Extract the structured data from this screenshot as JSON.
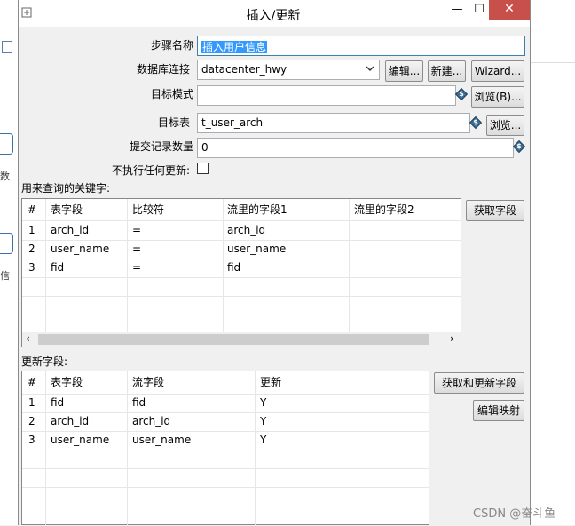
{
  "window": {
    "title": "插入/更新",
    "minimize_glyph": "—",
    "maximize_glyph": "☐",
    "close_glyph": "✕"
  },
  "background": {
    "left_fragment_1": "数",
    "left_fragment_2": "信",
    "right_fragment": "ad"
  },
  "form": {
    "step_name_label": "步骤名称",
    "step_name_value": "插入用户信息",
    "db_connection_label": "数据库连接",
    "db_connection_value": "datacenter_hwy",
    "edit_button": "编辑...",
    "new_button": "新建...",
    "wizard_button": "Wizard...",
    "target_schema_label": "目标模式",
    "target_schema_value": "",
    "browse_schema_button": "浏览(B)...",
    "target_table_label": "目标表",
    "target_table_value": "t_user_arch",
    "browse_table_button": "浏览...",
    "commit_size_label": "提交记录数量",
    "commit_size_value": "0",
    "no_update_label": "不执行任何更新:",
    "no_update_checked": false,
    "variable_icon_glyph": "$"
  },
  "key_section": {
    "label": "用来查询的关键字:",
    "get_fields_button": "获取字段",
    "columns": [
      "#",
      "表字段",
      "比较符",
      "流里的字段1",
      "流里的字段2"
    ],
    "rows": [
      [
        "1",
        "arch_id",
        "=",
        "arch_id",
        ""
      ],
      [
        "2",
        "user_name",
        "=",
        "user_name",
        ""
      ],
      [
        "3",
        "fid",
        "=",
        "fid",
        ""
      ]
    ],
    "scroll_left": "‹",
    "scroll_right": "›"
  },
  "update_section": {
    "label": "更新字段:",
    "get_update_fields_button": "获取和更新字段",
    "edit_mapping_button": "编辑映射",
    "columns": [
      "#",
      "表字段",
      "流字段",
      "更新"
    ],
    "rows": [
      [
        "1",
        "fid",
        "fid",
        "Y"
      ],
      [
        "2",
        "arch_id",
        "arch_id",
        "Y"
      ],
      [
        "3",
        "user_name",
        "user_name",
        "Y"
      ]
    ]
  },
  "watermark": "CSDN @奋斗鱼",
  "colors": {
    "close_button": "#c7504a",
    "selection": "#3399ff",
    "focus_border": "#3c7fb1",
    "variable_icon": "#3b6b94"
  }
}
